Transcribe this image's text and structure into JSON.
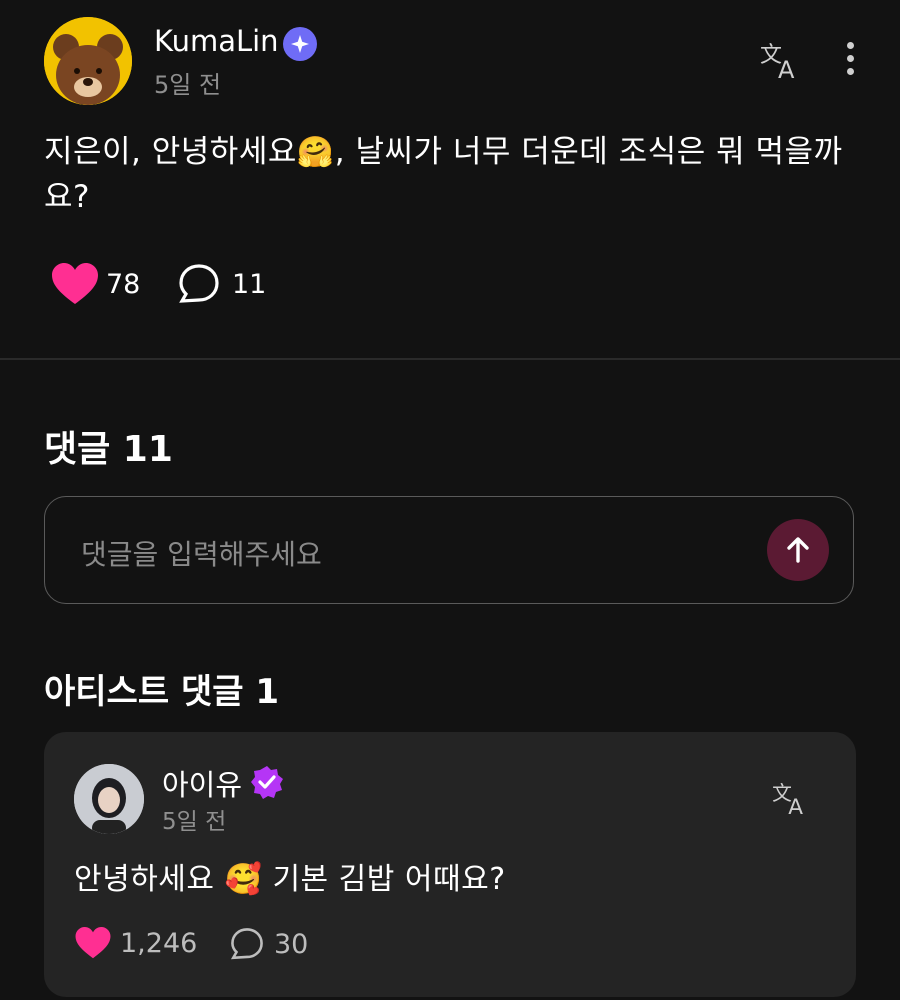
{
  "post": {
    "author": "KumaLin",
    "time": "5일 전",
    "body_part1": "지은이,  안녕하세요",
    "body_emoji": "🤗",
    "body_part2": ",   날씨가 너무 더운데 조식은 뭐 먹을까요?",
    "likes": "78",
    "comments": "11"
  },
  "comments_section": {
    "title": "댓글 11",
    "input_placeholder": "댓글을 입력해주세요"
  },
  "artist_section": {
    "title": "아티스트 댓글 1",
    "comment": {
      "author": "아이유",
      "time": "5일 전",
      "body_part1": "안녕하세요 ",
      "body_emoji": "🥰",
      "body_part2": " 기본 김밥 어때요?",
      "likes": "1,246",
      "comments": "30"
    }
  },
  "colors": {
    "background": "#121212",
    "like_heart": "#ff2f92",
    "verified_blue": "#6f6cf6",
    "verified_purple": "#b535f6",
    "send_button": "#5b1a33"
  }
}
